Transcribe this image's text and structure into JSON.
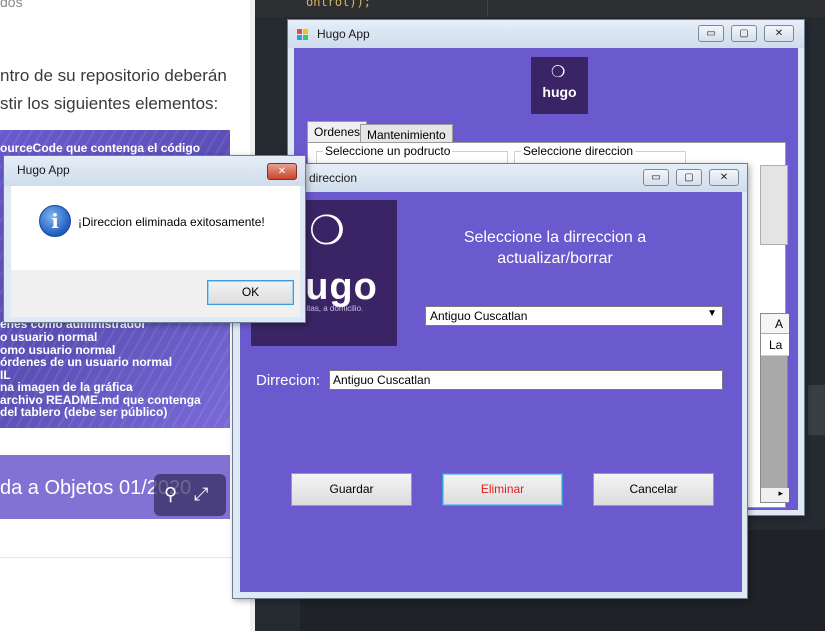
{
  "webpage": {
    "top_text": "dos",
    "para_line1": "ntro de su repositorio deberán",
    "para_line2": "stir los siguientes elementos:",
    "image_lines": [
      "ourceCode que contenga el código",
      "enes como administrador",
      "o usuario normal",
      "omo usuario normal",
      "órdenes de un usuario normal",
      "IL",
      "na imagen de la gráfica",
      "archivo README.md que contenga",
      "del tablero (debe ser público)"
    ],
    "banner_text": "da a Objetos 01/2020",
    "share_icon": "share-icon",
    "expand_icon": "expand-icon"
  },
  "ide": {
    "code_snippet": "ontrol));"
  },
  "main_window": {
    "title": "Hugo App",
    "logo_word": "hugo",
    "tabs": [
      "Ordenes",
      "Mantenimiento"
    ],
    "group_product": "Seleccione un podructo",
    "group_address": "Seleccione direccion",
    "grid_header": "A",
    "grid_cell": "La"
  },
  "direccion_window": {
    "title": "direccion",
    "logo_word": "hugo",
    "logo_tagline": "necesitas, a domicilio.",
    "heading": "Seleccione la dirreccion a actualizar/borrar",
    "select_value": "Antiguo Cuscatlan",
    "address_label": "Dirrecion:",
    "address_value": "Antiguo Cuscatlan",
    "buttons": {
      "save": "Guardar",
      "delete": "Eliminar",
      "cancel": "Cancelar"
    }
  },
  "message_box": {
    "title": "Hugo App",
    "message": "¡Direccion eliminada exitosamente!",
    "ok": "OK"
  },
  "titlebar_buttons": {
    "minimize": "▭",
    "maximize": "▢",
    "close": "✕"
  }
}
